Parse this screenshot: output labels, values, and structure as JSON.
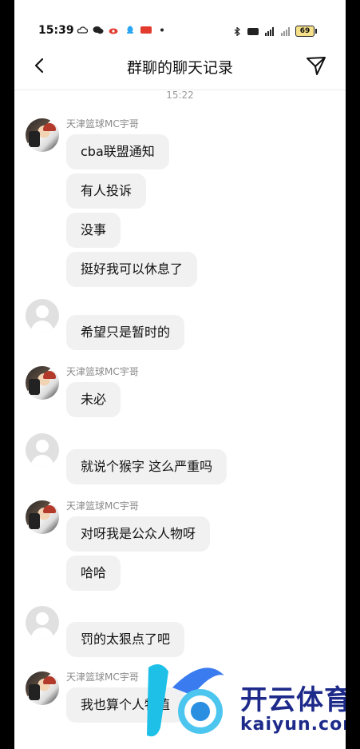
{
  "status_bar": {
    "time": "15:39",
    "battery": "69"
  },
  "navbar": {
    "title": "群聊的聊天记录"
  },
  "chat": {
    "timestamp": "15:22",
    "groups": [
      {
        "sender": "天津篮球MC宇哥",
        "avatar": "photo",
        "messages": [
          "cba联盟通知",
          "有人投诉",
          "没事",
          "挺好我可以休息了"
        ]
      },
      {
        "sender": "",
        "avatar": "default",
        "messages": [
          "希望只是暂时的"
        ]
      },
      {
        "sender": "天津篮球MC宇哥",
        "avatar": "photo",
        "messages": [
          "未必"
        ]
      },
      {
        "sender": "",
        "avatar": "default",
        "messages": [
          "就说个猴字 这么严重吗"
        ]
      },
      {
        "sender": "天津篮球MC宇哥",
        "avatar": "photo",
        "messages": [
          "对呀我是公众人物呀",
          "哈哈"
        ]
      },
      {
        "sender": "",
        "avatar": "default",
        "messages": [
          "罚的太狠点了吧"
        ]
      },
      {
        "sender": "天津篮球MC宇哥",
        "avatar": "photo",
        "messages": [
          "我也算个人物值"
        ]
      }
    ]
  },
  "watermark": {
    "brand_cn": "开云体育",
    "brand_en": "kaiyun.com"
  },
  "colors": {
    "bubble": "#f1f1f1",
    "sender_name": "#8a8a8a",
    "watermark": "#1d2a8a"
  }
}
